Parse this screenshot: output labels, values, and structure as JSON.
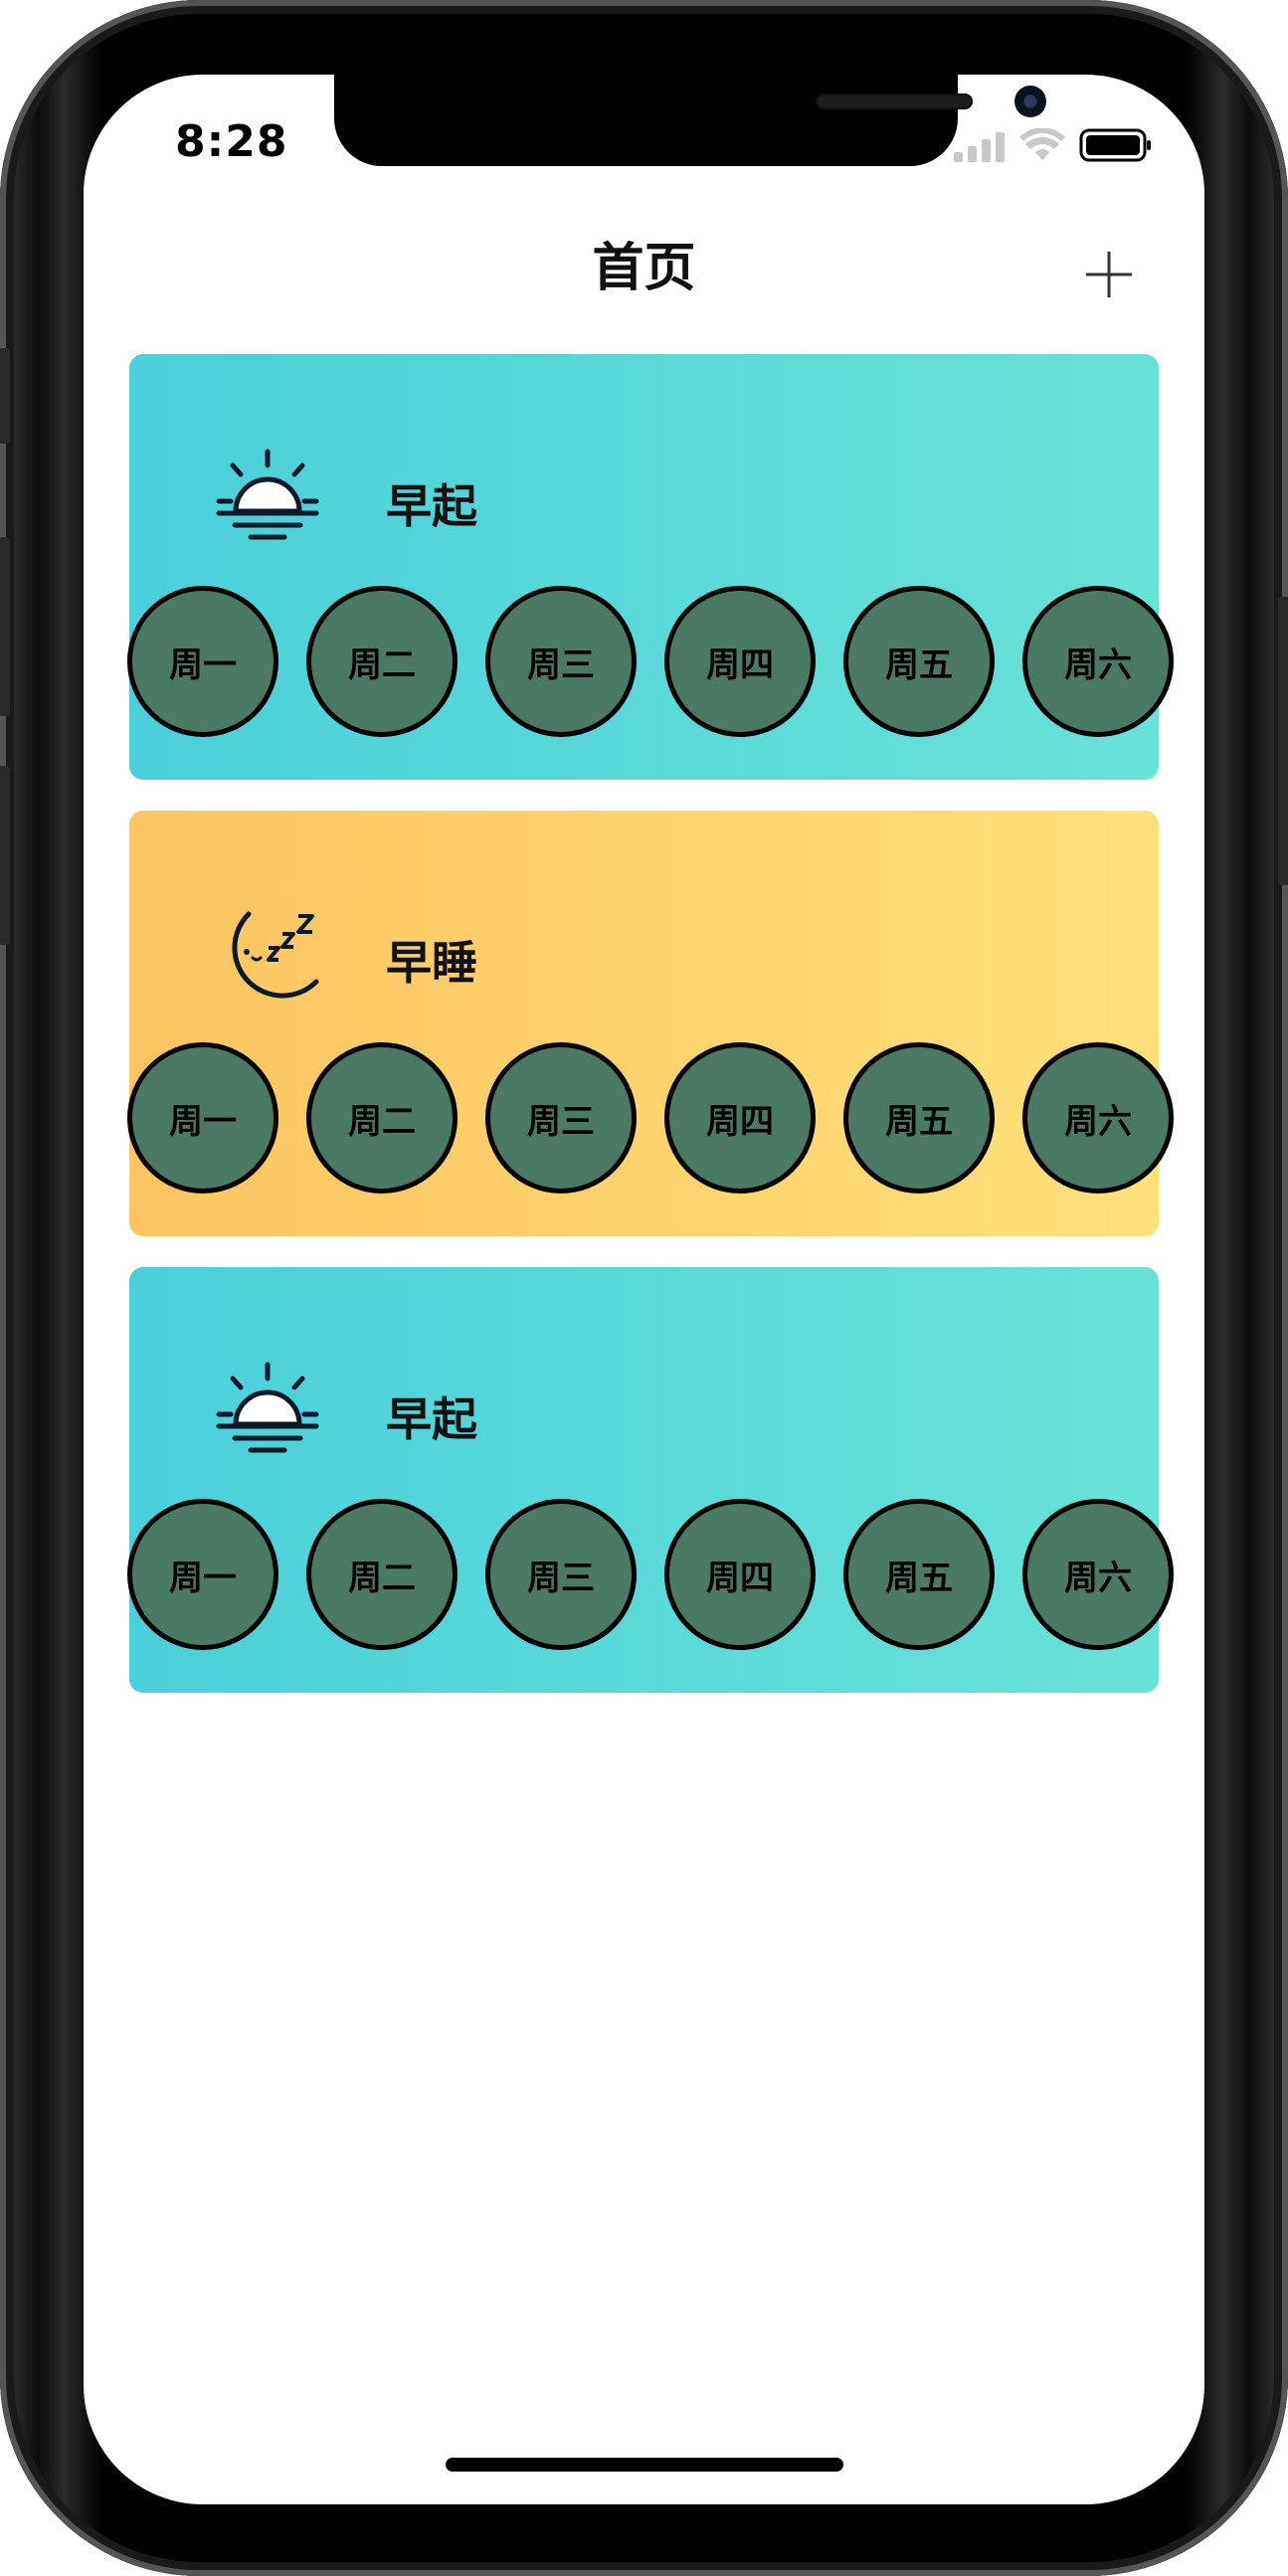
{
  "status": {
    "time": "8:28"
  },
  "nav": {
    "title": "首页",
    "add_icon": "plus-icon"
  },
  "cards": [
    {
      "theme": "sun",
      "icon": "sunrise-icon",
      "title": "早起",
      "days": [
        "周一",
        "周二",
        "周三",
        "周四",
        "周五",
        "周六"
      ]
    },
    {
      "theme": "moon",
      "icon": "moon-sleep-icon",
      "title": "早睡",
      "days": [
        "周一",
        "周二",
        "周三",
        "周四",
        "周五",
        "周六"
      ]
    },
    {
      "theme": "sun",
      "icon": "sunrise-icon",
      "title": "早起",
      "days": [
        "周一",
        "周二",
        "周三",
        "周四",
        "周五",
        "周六"
      ]
    }
  ],
  "colors": {
    "sun_gradient": [
      "#4ad0da",
      "#69e2d6"
    ],
    "moon_gradient": [
      "#fdc561",
      "#fee07a"
    ],
    "day_button": "#4a7a66"
  }
}
